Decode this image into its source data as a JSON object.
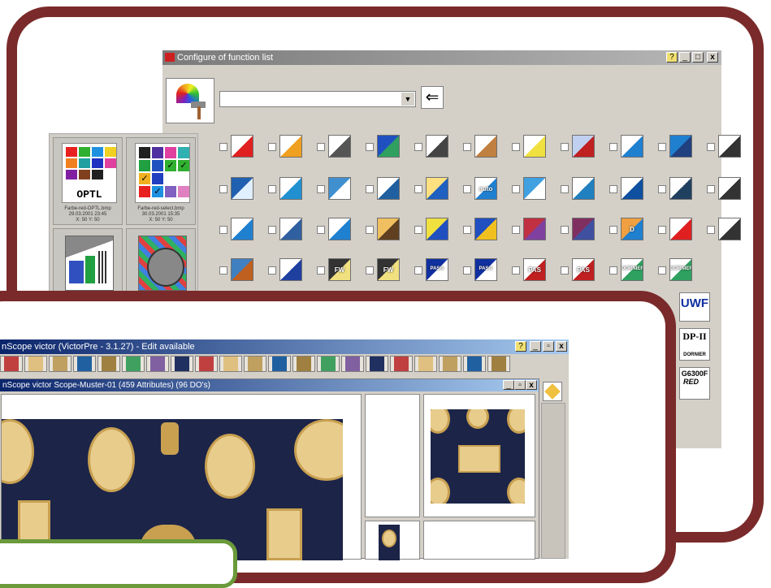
{
  "config_window": {
    "title": "Configure of function list",
    "dropdown_value": "",
    "title_buttons": [
      "?",
      "_",
      "□",
      "x"
    ],
    "icon_names": [
      "help-icon",
      "minimize-icon",
      "maximize-icon",
      "close-icon"
    ]
  },
  "thumbnails": [
    {
      "label": "OPTL",
      "file": "Farbe-red-OPTL.bmp",
      "date": "29.03.2001 23:45",
      "coords": "X: 50  Y: 50"
    },
    {
      "label": "",
      "file": "Farbe-red-select.bmp",
      "date": "30.03.2001 15:35",
      "coords": "X: 50  Y: 50"
    }
  ],
  "function_icons": {
    "row1": [
      "",
      "",
      "",
      "",
      "",
      "",
      "",
      "",
      "",
      "",
      ""
    ],
    "row2": [
      "",
      "",
      "",
      "",
      "",
      "auto",
      "",
      "",
      "",
      "",
      ""
    ],
    "row3": [
      "",
      "",
      "",
      "",
      "",
      "",
      "",
      "",
      "D",
      "",
      ""
    ],
    "row4": [
      "",
      "",
      "FW",
      "FW",
      "PAS/1",
      "PAS/1",
      "PAS",
      "PAS",
      "DORNIER",
      "DORNIER"
    ],
    "extra": [
      "UWF",
      "DP-II",
      "G6300F"
    ],
    "dp_sub": "DORNIER",
    "g_sub": "RED"
  },
  "main_window": {
    "title": "nScope victor (VictorPre - 3.1.27) - Edit available",
    "doc_title": "nScope victor Scope-Muster-01 (459 Attributes) (96 DO's)"
  },
  "colors": {
    "frame": "#7a2a2a",
    "titlebar_dark": "#0a246a",
    "titlebar_light": "#a6caf0",
    "carpet_bg": "#1c2448",
    "ornament": "#c8a050"
  }
}
